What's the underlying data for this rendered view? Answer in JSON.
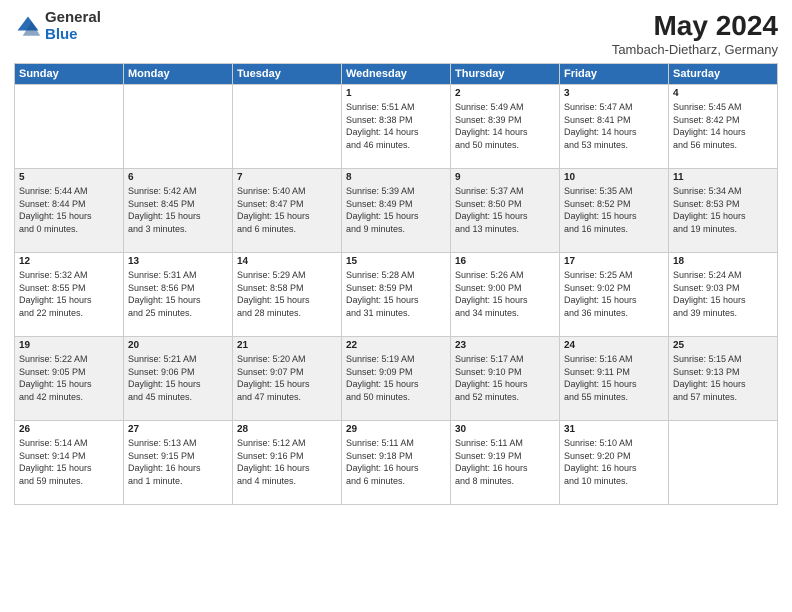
{
  "logo": {
    "general": "General",
    "blue": "Blue"
  },
  "title": "May 2024",
  "subtitle": "Tambach-Dietharz, Germany",
  "weekdays": [
    "Sunday",
    "Monday",
    "Tuesday",
    "Wednesday",
    "Thursday",
    "Friday",
    "Saturday"
  ],
  "weeks": [
    [
      {
        "day": "",
        "info": ""
      },
      {
        "day": "",
        "info": ""
      },
      {
        "day": "",
        "info": ""
      },
      {
        "day": "1",
        "info": "Sunrise: 5:51 AM\nSunset: 8:38 PM\nDaylight: 14 hours\nand 46 minutes."
      },
      {
        "day": "2",
        "info": "Sunrise: 5:49 AM\nSunset: 8:39 PM\nDaylight: 14 hours\nand 50 minutes."
      },
      {
        "day": "3",
        "info": "Sunrise: 5:47 AM\nSunset: 8:41 PM\nDaylight: 14 hours\nand 53 minutes."
      },
      {
        "day": "4",
        "info": "Sunrise: 5:45 AM\nSunset: 8:42 PM\nDaylight: 14 hours\nand 56 minutes."
      }
    ],
    [
      {
        "day": "5",
        "info": "Sunrise: 5:44 AM\nSunset: 8:44 PM\nDaylight: 15 hours\nand 0 minutes."
      },
      {
        "day": "6",
        "info": "Sunrise: 5:42 AM\nSunset: 8:45 PM\nDaylight: 15 hours\nand 3 minutes."
      },
      {
        "day": "7",
        "info": "Sunrise: 5:40 AM\nSunset: 8:47 PM\nDaylight: 15 hours\nand 6 minutes."
      },
      {
        "day": "8",
        "info": "Sunrise: 5:39 AM\nSunset: 8:49 PM\nDaylight: 15 hours\nand 9 minutes."
      },
      {
        "day": "9",
        "info": "Sunrise: 5:37 AM\nSunset: 8:50 PM\nDaylight: 15 hours\nand 13 minutes."
      },
      {
        "day": "10",
        "info": "Sunrise: 5:35 AM\nSunset: 8:52 PM\nDaylight: 15 hours\nand 16 minutes."
      },
      {
        "day": "11",
        "info": "Sunrise: 5:34 AM\nSunset: 8:53 PM\nDaylight: 15 hours\nand 19 minutes."
      }
    ],
    [
      {
        "day": "12",
        "info": "Sunrise: 5:32 AM\nSunset: 8:55 PM\nDaylight: 15 hours\nand 22 minutes."
      },
      {
        "day": "13",
        "info": "Sunrise: 5:31 AM\nSunset: 8:56 PM\nDaylight: 15 hours\nand 25 minutes."
      },
      {
        "day": "14",
        "info": "Sunrise: 5:29 AM\nSunset: 8:58 PM\nDaylight: 15 hours\nand 28 minutes."
      },
      {
        "day": "15",
        "info": "Sunrise: 5:28 AM\nSunset: 8:59 PM\nDaylight: 15 hours\nand 31 minutes."
      },
      {
        "day": "16",
        "info": "Sunrise: 5:26 AM\nSunset: 9:00 PM\nDaylight: 15 hours\nand 34 minutes."
      },
      {
        "day": "17",
        "info": "Sunrise: 5:25 AM\nSunset: 9:02 PM\nDaylight: 15 hours\nand 36 minutes."
      },
      {
        "day": "18",
        "info": "Sunrise: 5:24 AM\nSunset: 9:03 PM\nDaylight: 15 hours\nand 39 minutes."
      }
    ],
    [
      {
        "day": "19",
        "info": "Sunrise: 5:22 AM\nSunset: 9:05 PM\nDaylight: 15 hours\nand 42 minutes."
      },
      {
        "day": "20",
        "info": "Sunrise: 5:21 AM\nSunset: 9:06 PM\nDaylight: 15 hours\nand 45 minutes."
      },
      {
        "day": "21",
        "info": "Sunrise: 5:20 AM\nSunset: 9:07 PM\nDaylight: 15 hours\nand 47 minutes."
      },
      {
        "day": "22",
        "info": "Sunrise: 5:19 AM\nSunset: 9:09 PM\nDaylight: 15 hours\nand 50 minutes."
      },
      {
        "day": "23",
        "info": "Sunrise: 5:17 AM\nSunset: 9:10 PM\nDaylight: 15 hours\nand 52 minutes."
      },
      {
        "day": "24",
        "info": "Sunrise: 5:16 AM\nSunset: 9:11 PM\nDaylight: 15 hours\nand 55 minutes."
      },
      {
        "day": "25",
        "info": "Sunrise: 5:15 AM\nSunset: 9:13 PM\nDaylight: 15 hours\nand 57 minutes."
      }
    ],
    [
      {
        "day": "26",
        "info": "Sunrise: 5:14 AM\nSunset: 9:14 PM\nDaylight: 15 hours\nand 59 minutes."
      },
      {
        "day": "27",
        "info": "Sunrise: 5:13 AM\nSunset: 9:15 PM\nDaylight: 16 hours\nand 1 minute."
      },
      {
        "day": "28",
        "info": "Sunrise: 5:12 AM\nSunset: 9:16 PM\nDaylight: 16 hours\nand 4 minutes."
      },
      {
        "day": "29",
        "info": "Sunrise: 5:11 AM\nSunset: 9:18 PM\nDaylight: 16 hours\nand 6 minutes."
      },
      {
        "day": "30",
        "info": "Sunrise: 5:11 AM\nSunset: 9:19 PM\nDaylight: 16 hours\nand 8 minutes."
      },
      {
        "day": "31",
        "info": "Sunrise: 5:10 AM\nSunset: 9:20 PM\nDaylight: 16 hours\nand 10 minutes."
      },
      {
        "day": "",
        "info": ""
      }
    ]
  ]
}
